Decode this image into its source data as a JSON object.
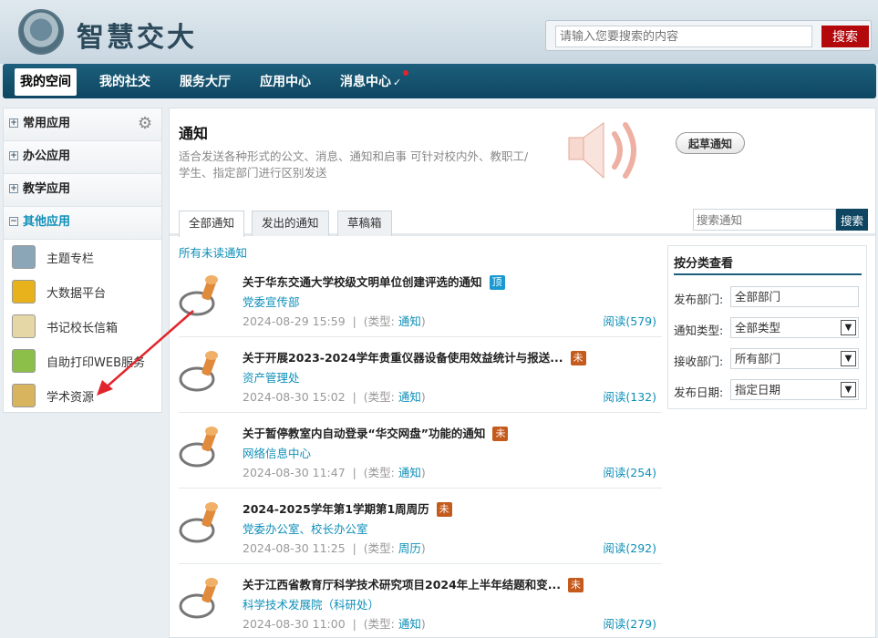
{
  "header": {
    "logo_text": "智慧交大",
    "search_placeholder": "请输入您要搜索的内容",
    "search_button": "搜索"
  },
  "nav": {
    "items": [
      {
        "label": "我的空间",
        "active": true
      },
      {
        "label": "我的社交"
      },
      {
        "label": "服务大厅"
      },
      {
        "label": "应用中心"
      },
      {
        "label": "消息中心"
      }
    ]
  },
  "sidebar": {
    "groups": [
      {
        "label": "常用应用",
        "expanded": false
      },
      {
        "label": "办公应用",
        "expanded": false
      },
      {
        "label": "教学应用",
        "expanded": false
      },
      {
        "label": "其他应用",
        "expanded": true
      }
    ],
    "apps": [
      {
        "label": "主题专栏",
        "icon": "theme-column-icon",
        "color": "#8ba6b7"
      },
      {
        "label": "大数据平台",
        "icon": "bar-chart-icon",
        "color": "#e7b21c"
      },
      {
        "label": "书记校长信箱",
        "icon": "mailbox-icon",
        "color": "#e6d7a6"
      },
      {
        "label": "自助打印WEB服务",
        "icon": "download-print-icon",
        "color": "#8cbf4a"
      },
      {
        "label": "学术资源",
        "icon": "notepad-icon",
        "color": "#d8b45e"
      }
    ]
  },
  "main": {
    "title": "通知",
    "description": "适合发送各种形式的公文、消息、通知和启事 可针对校内外、教职工/学生、指定部门进行区别发送",
    "draft_button": "起草通知",
    "tabs": [
      {
        "label": "全部通知",
        "active": true
      },
      {
        "label": "发出的通知"
      },
      {
        "label": "草稿箱"
      }
    ],
    "search_placeholder": "搜索通知",
    "search_button": "搜索",
    "unread_link": "所有未读通知",
    "type_prefix": "(类型:",
    "type_suffix": ")",
    "notices": [
      {
        "title": "关于华东交通大学校级文明单位创建评选的通知",
        "badge": "顶",
        "badge_kind": "top",
        "dept": "党委宣传部",
        "date": "2024-08-29 15:59",
        "type": "通知",
        "reads": "阅读(579)"
      },
      {
        "title": "关于开展2023-2024学年贵重仪器设备使用效益统计与报送...",
        "badge": "未",
        "badge_kind": "unread",
        "dept": "资产管理处",
        "date": "2024-08-30 15:02",
        "type": "通知",
        "reads": "阅读(132)"
      },
      {
        "title": "关于暂停教室内自动登录“华交网盘”功能的通知",
        "badge": "未",
        "badge_kind": "unread",
        "dept": "网络信息中心",
        "date": "2024-08-30 11:47",
        "type": "通知",
        "reads": "阅读(254)"
      },
      {
        "title": "2024-2025学年第1学期第1周周历",
        "badge": "未",
        "badge_kind": "unread",
        "dept": "党委办公室、校长办公室",
        "date": "2024-08-30 11:25",
        "type": "周历",
        "reads": "阅读(292)"
      },
      {
        "title": "关于江西省教育厅科学技术研究项目2024年上半年结题和变...",
        "badge": "未",
        "badge_kind": "unread",
        "dept": "科学技术发展院（科研处）",
        "date": "2024-08-30 11:00",
        "type": "通知",
        "reads": "阅读(279)"
      }
    ]
  },
  "filter": {
    "title": "按分类查看",
    "rows": [
      {
        "label": "发布部门:",
        "value": "全部部门",
        "dropdown": false
      },
      {
        "label": "通知类型:",
        "value": "全部类型",
        "dropdown": true
      },
      {
        "label": "接收部门:",
        "value": "所有部门",
        "dropdown": true
      },
      {
        "label": "发布日期:",
        "value": "指定日期",
        "dropdown": true
      }
    ]
  },
  "colors": {
    "nav_bg": "#0e4662",
    "accent_link": "#0e8fb8",
    "search_red": "#b3090d",
    "annotation_arrow": "#e0262c"
  }
}
